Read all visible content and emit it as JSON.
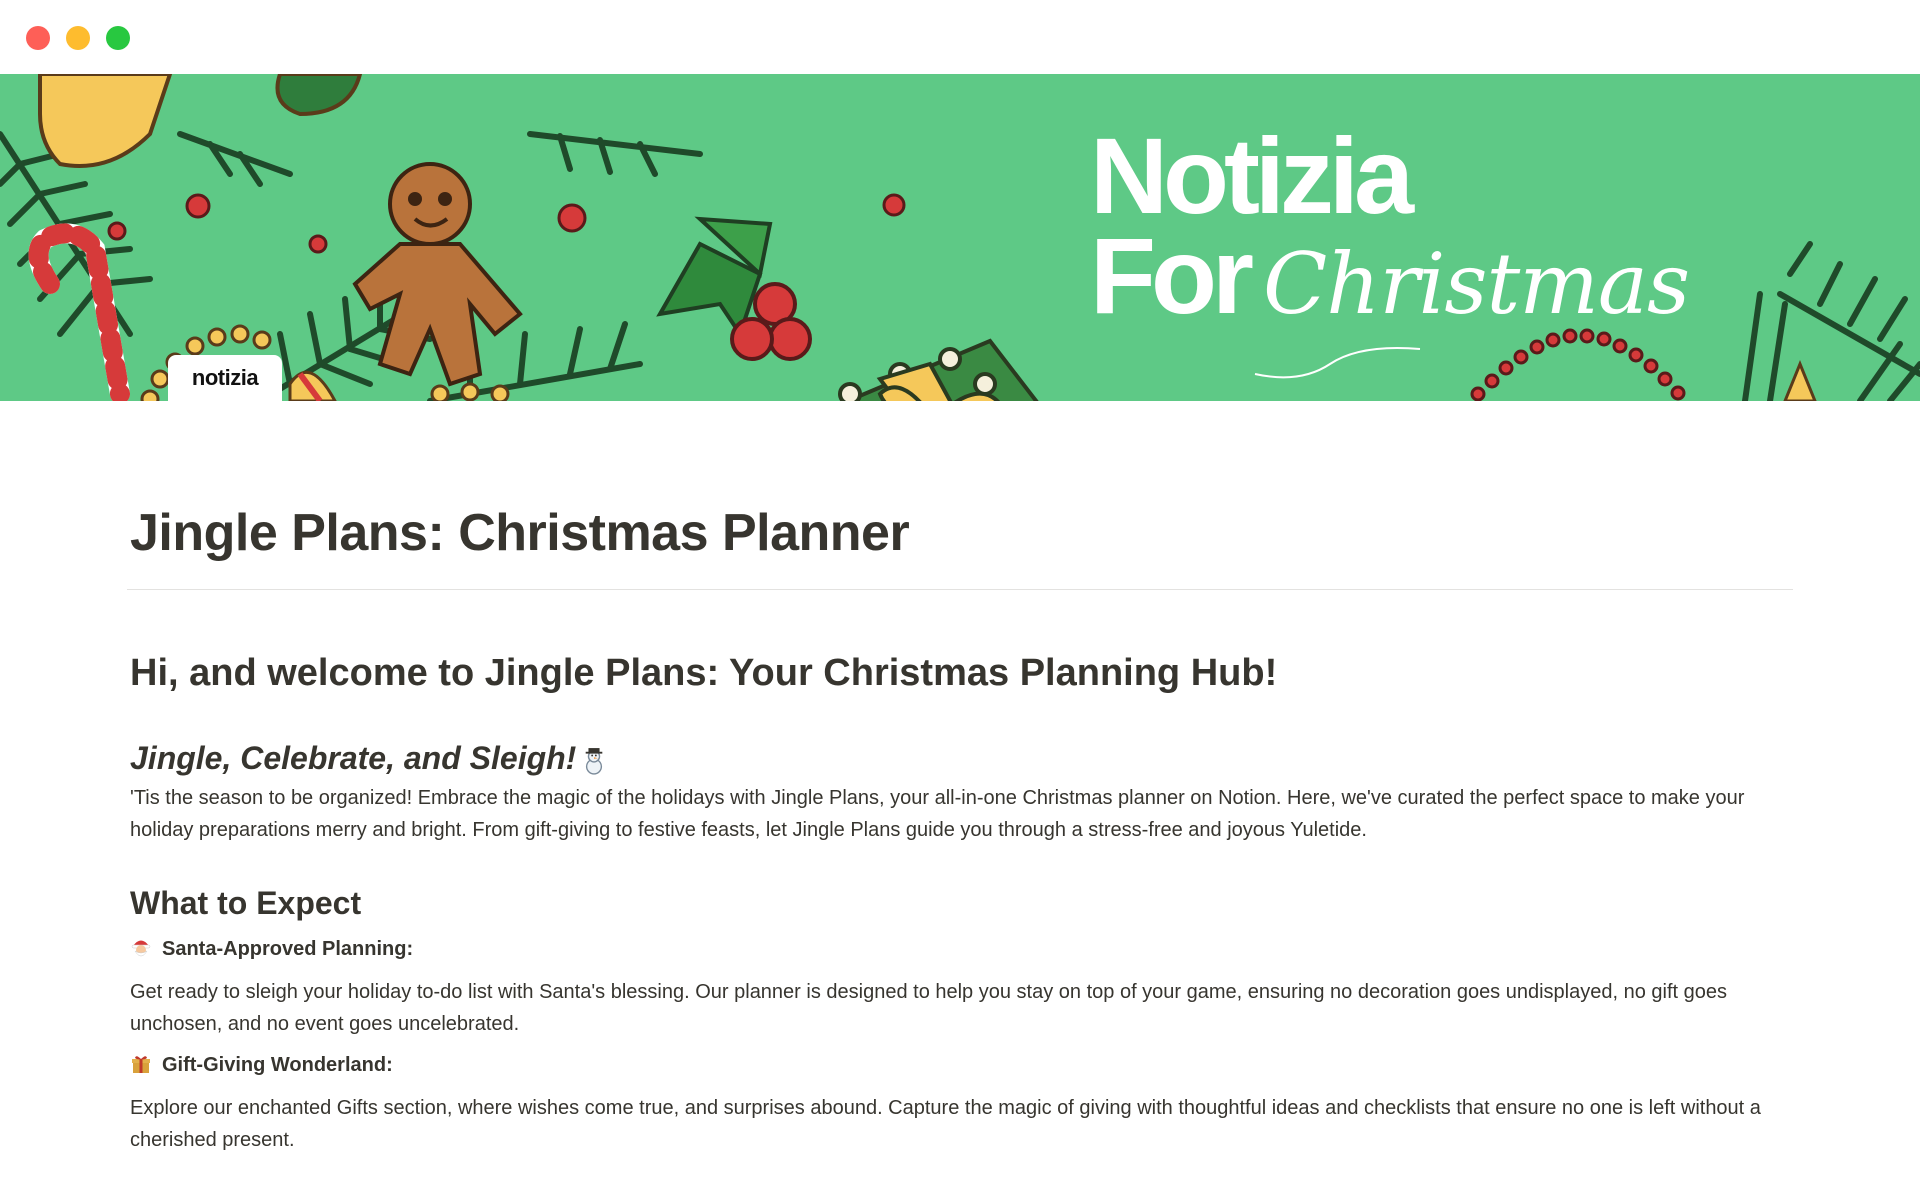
{
  "window": {
    "controls": [
      "close-button",
      "minimize-button",
      "zoom-button"
    ]
  },
  "cover": {
    "brand_line1": "Notizia",
    "brand_for": "For",
    "brand_script": "Christmas",
    "logo_tab": "notizia",
    "bg_color": "#5ec986"
  },
  "page": {
    "title": "Jingle Plans: Christmas Planner",
    "welcome_heading": "Hi, and welcome to Jingle Plans: Your Christmas Planning Hub!",
    "tagline": "Jingle, Celebrate, and Sleigh!",
    "tagline_icon": "snowman-icon",
    "intro": "'Tis the season to be organized! Embrace the magic of the holidays with Jingle Plans, your all-in-one Christmas planner on Notion. Here, we've curated the perfect space to make your holiday preparations merry and bright. From gift-giving to festive feasts, let Jingle Plans guide you through a stress-free and joyous Yuletide.",
    "expect_heading": "What to Expect",
    "features": [
      {
        "icon": "santa-icon",
        "title": "Santa-Approved Planning:",
        "desc": "Get ready to sleigh your holiday to-do list with Santa's blessing. Our planner is designed to help you stay on top of your game, ensuring no decoration goes undisplayed, no gift goes unchosen, and no event goes uncelebrated."
      },
      {
        "icon": "gift-icon",
        "title": "Gift-Giving Wonderland:",
        "desc": "Explore our enchanted Gifts section, where wishes come true, and surprises abound. Capture the magic of giving with thoughtful ideas and checklists that ensure no one is left without a cherished present."
      }
    ]
  }
}
